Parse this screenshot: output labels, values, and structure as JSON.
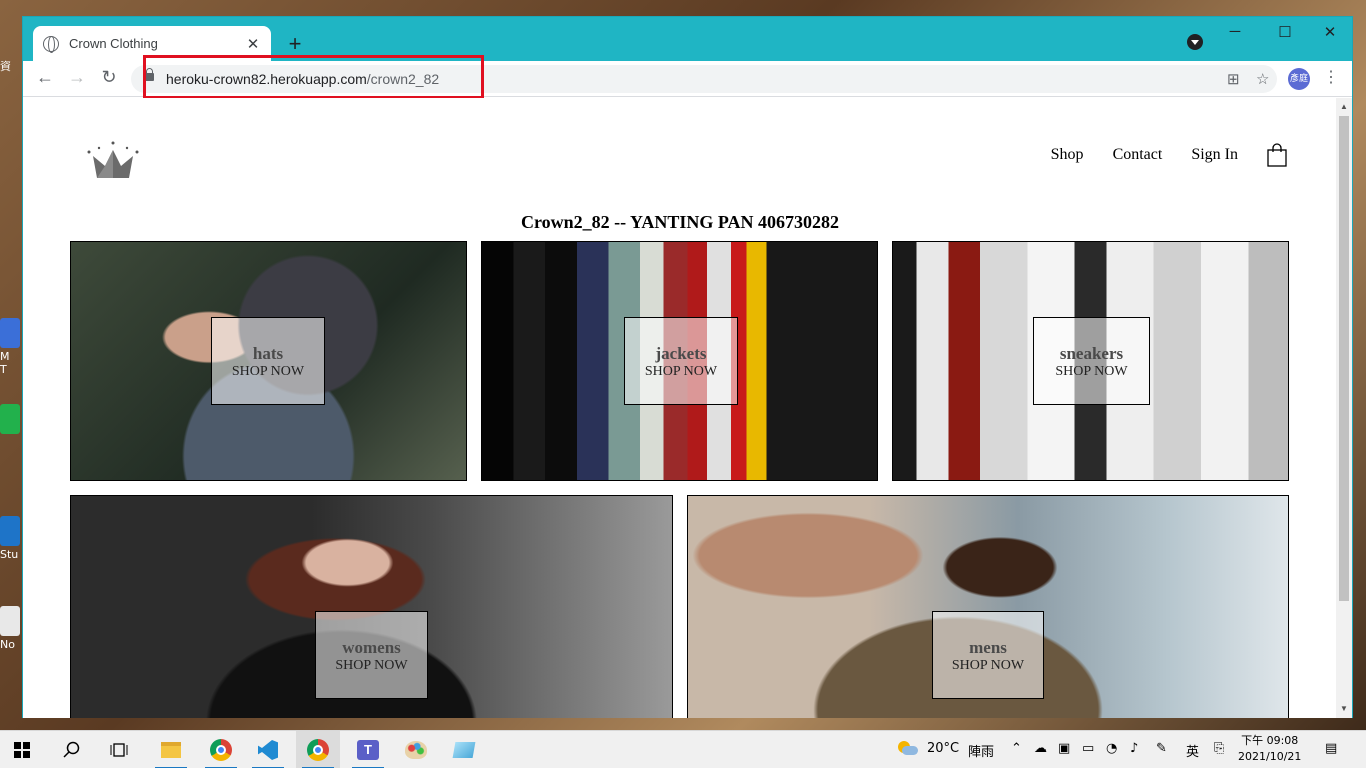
{
  "browser": {
    "tab_title": "Crown Clothing",
    "tab_close": "✕",
    "new_tab": "+",
    "url_host": "heroku-crown82.herokuapp.com",
    "url_path": "/crown2_82",
    "window_minimize": "─",
    "window_maximize": "☐",
    "window_close": "✕",
    "avatar_text": "彥庭"
  },
  "site": {
    "nav": {
      "shop": "Shop",
      "contact": "Contact",
      "sign_in": "Sign In"
    },
    "heading": "Crown2_82 -- YANTING PAN 406730282",
    "categories": [
      {
        "name": "hats",
        "cta": "SHOP NOW"
      },
      {
        "name": "jackets",
        "cta": "SHOP NOW"
      },
      {
        "name": "sneakers",
        "cta": "SHOP NOW"
      },
      {
        "name": "womens",
        "cta": "SHOP NOW"
      },
      {
        "name": "mens",
        "cta": "SHOP NOW"
      }
    ]
  },
  "desktop_icons": [
    "資",
    "M",
    "T",
    "Stu",
    "No"
  ],
  "taskbar": {
    "weather_temp": "20°C",
    "weather_text": "陣雨",
    "ime": "英",
    "time": "下午 09:08",
    "date": "2021/10/21"
  },
  "colors": {
    "tab_bar": "#1fb5c4",
    "highlight_box": "#e01020"
  }
}
